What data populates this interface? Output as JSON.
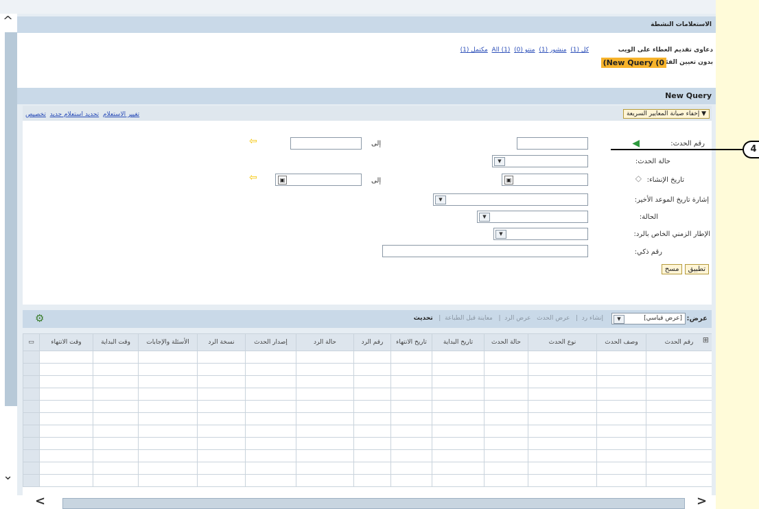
{
  "active_queries": {
    "title": "الاستعلامات النشطة",
    "row1_label": "دعاوى تقديم العطاء على الويب",
    "row1_links": [
      "كل (1)",
      "منشور (1)",
      "منتو (0)",
      "(1) All",
      "(All (1",
      "مكتمل (1)"
    ],
    "row2_label": "بدون تعيين الفئة",
    "row2_tag": "(New Query (0"
  },
  "query": {
    "title": "New Query",
    "hide_criteria": "إخفاء صيانة المعايير السريعة",
    "top_links": [
      "تغيير الاستعلام",
      "تحديد استعلام جديد",
      "تخصيص"
    ],
    "labels": {
      "event_number": "رقم الحدث:",
      "event_status": "حالة الحدث:",
      "creation_date": "تاريخ الإنشاء:",
      "last_due_date": "إشارة تاريخ الموعد الأخير:",
      "status": "الحالة:",
      "timeframe": "الإطار الزمني الخاص بالرد:",
      "smart_number": "رقم ذكي:",
      "to": "إلى",
      "to2": "إلى"
    },
    "apply_button": "تطبيق",
    "clear_button": "مسح"
  },
  "toolbar": {
    "view_label": "عرض:",
    "view_value": "[عرض قياسي]",
    "actions": [
      "إنشاء رد",
      "عرض الحدث",
      "عرض الرد",
      "معاينة قبل الطباعة",
      "تحديث"
    ]
  },
  "table": {
    "columns": [
      "رقم الحدث",
      "وصف الحدث",
      "نوع الحدث",
      "حالة الحدث",
      "تاريخ البداية",
      "تاريخ الانتهاء",
      "رقم الرد",
      "حالة الرد",
      "إصدار الحدث",
      "نسخة الرد",
      "الأسئلة والإجابات",
      "وقت البداية",
      "وقت الانتهاء"
    ]
  },
  "callout": {
    "number": "4"
  },
  "colors": {
    "header": "#c9d9e8",
    "tag": "#f7b32b",
    "arrow": "#2f9a3f"
  }
}
